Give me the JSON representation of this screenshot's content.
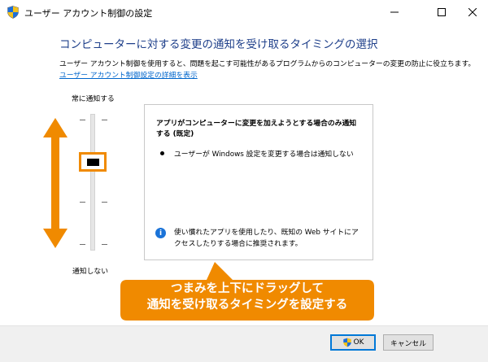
{
  "window": {
    "title": "ユーザー アカウント制御の設定",
    "icon": "uac-shield-icon"
  },
  "main": {
    "heading": "コンピューターに対する変更の通知を受け取るタイミングの選択",
    "description": "ユーザー アカウント制御を使用すると、問題を起こす可能性があるプログラムからのコンピューターの変更の防止に役立ちます。",
    "link": "ユーザー アカウント制御設定の詳細を表示"
  },
  "slider": {
    "top_label": "常に通知する",
    "bottom_label": "通知しない",
    "levels": 4,
    "selected_level": 2
  },
  "panel": {
    "title": "アプリがコンピューターに変更を加えようとする場合のみ通知する (既定)",
    "bullet": "ユーザーが Windows 設定を変更する場合は通知しない",
    "note": "使い慣れたアプリを使用したり、既知の Web サイトにアクセスしたりする場合に推奨されます。"
  },
  "callout": {
    "line1": "つまみを上下にドラッグして",
    "line2": "通知を受け取るタイミングを設定する"
  },
  "buttons": {
    "ok": "OK",
    "cancel": "キャンセル"
  },
  "colors": {
    "accent_orange": "#f08a00",
    "heading_blue": "#1e3f8a",
    "link_blue": "#0066cc",
    "info_blue": "#1a73d8"
  }
}
